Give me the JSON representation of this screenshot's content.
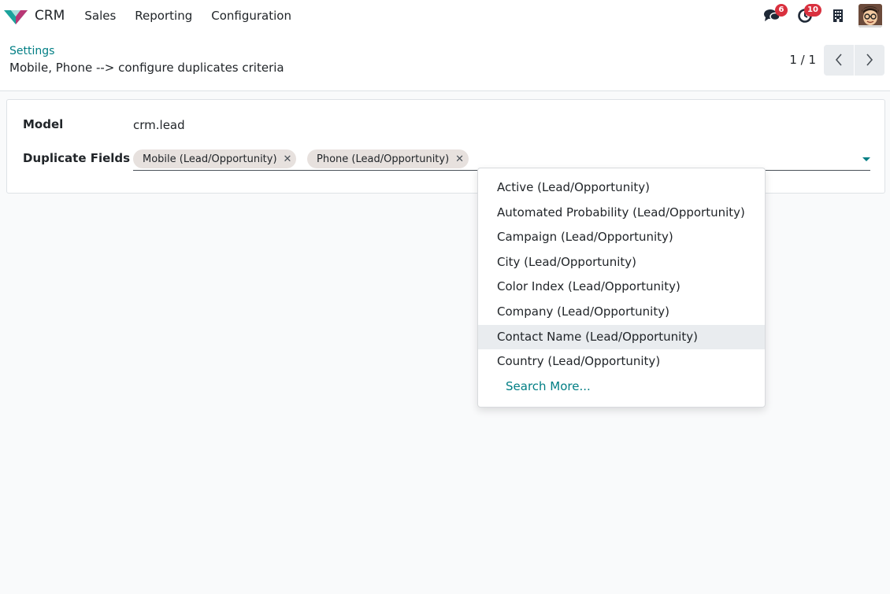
{
  "navbar": {
    "app_name": "CRM",
    "menu": [
      "Sales",
      "Reporting",
      "Configuration"
    ],
    "messages_count": "6",
    "activities_count": "10"
  },
  "breadcrumb": {
    "parent": "Settings",
    "current": "Mobile, Phone --> configure duplicates criteria"
  },
  "pager": {
    "value": "1 / 1"
  },
  "form": {
    "model_label": "Model",
    "model_value": "crm.lead",
    "duplicate_label": "Duplicate Fields",
    "tags": [
      "Mobile (Lead/Opportunity)",
      "Phone (Lead/Opportunity)"
    ]
  },
  "dropdown": {
    "items": [
      "Active (Lead/Opportunity)",
      "Automated Probability (Lead/Opportunity)",
      "Campaign (Lead/Opportunity)",
      "City (Lead/Opportunity)",
      "Color Index (Lead/Opportunity)",
      "Company (Lead/Opportunity)",
      "Contact Name (Lead/Opportunity)",
      "Country (Lead/Opportunity)"
    ],
    "highlighted_index": 6,
    "search_more": "Search More..."
  },
  "colors": {
    "accent": "#017e84",
    "badge": "#d9303e",
    "tag_bg": "#e7e1de"
  }
}
